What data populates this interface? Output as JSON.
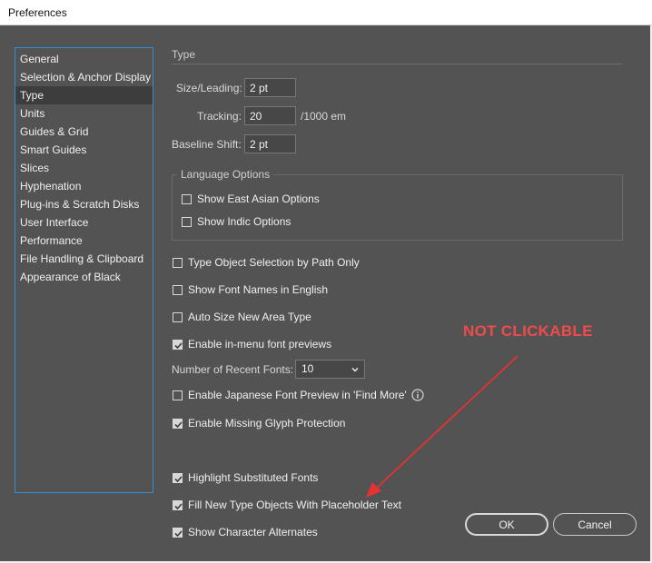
{
  "window": {
    "title": "Preferences"
  },
  "sidebar": {
    "items": [
      {
        "label": "General"
      },
      {
        "label": "Selection & Anchor Display"
      },
      {
        "label": "Type",
        "selected": true
      },
      {
        "label": "Units"
      },
      {
        "label": "Guides & Grid"
      },
      {
        "label": "Smart Guides"
      },
      {
        "label": "Slices"
      },
      {
        "label": "Hyphenation"
      },
      {
        "label": "Plug-ins & Scratch Disks"
      },
      {
        "label": "User Interface"
      },
      {
        "label": "Performance"
      },
      {
        "label": "File Handling & Clipboard"
      },
      {
        "label": "Appearance of Black"
      }
    ]
  },
  "type_section": {
    "title": "Type",
    "size_leading": {
      "label": "Size/Leading:",
      "value": "2 pt"
    },
    "tracking": {
      "label": "Tracking:",
      "value": "20",
      "unit": "/1000 em"
    },
    "baseline_shift": {
      "label": "Baseline Shift:",
      "value": "2 pt"
    }
  },
  "language_options": {
    "title": "Language Options",
    "east_asian": {
      "label": "Show East Asian Options",
      "checked": false
    },
    "indic": {
      "label": "Show Indic Options",
      "checked": false
    }
  },
  "options": {
    "type_object_selection": {
      "label": "Type Object Selection by Path Only",
      "checked": false
    },
    "font_names_english": {
      "label": "Show Font Names in English",
      "checked": false
    },
    "auto_size": {
      "label": "Auto Size New Area Type",
      "checked": false
    },
    "font_previews": {
      "label": "Enable in-menu font previews",
      "checked": true
    },
    "recent_fonts": {
      "label": "Number of Recent Fonts:",
      "value": "10"
    },
    "japanese_preview": {
      "label": "Enable Japanese Font Preview in 'Find More'",
      "checked": false
    },
    "missing_glyph": {
      "label": "Enable Missing Glyph Protection",
      "checked": true
    },
    "highlight_substituted": {
      "label": "Highlight Substituted Fonts",
      "checked": true
    },
    "placeholder_text": {
      "label": "Fill New Type Objects With Placeholder Text",
      "checked": true
    },
    "character_alternates": {
      "label": "Show Character Alternates",
      "checked": true
    }
  },
  "annotation": {
    "text": "NOT CLICKABLE",
    "color": "#f04b4b"
  },
  "buttons": {
    "ok": "OK",
    "cancel": "Cancel"
  }
}
